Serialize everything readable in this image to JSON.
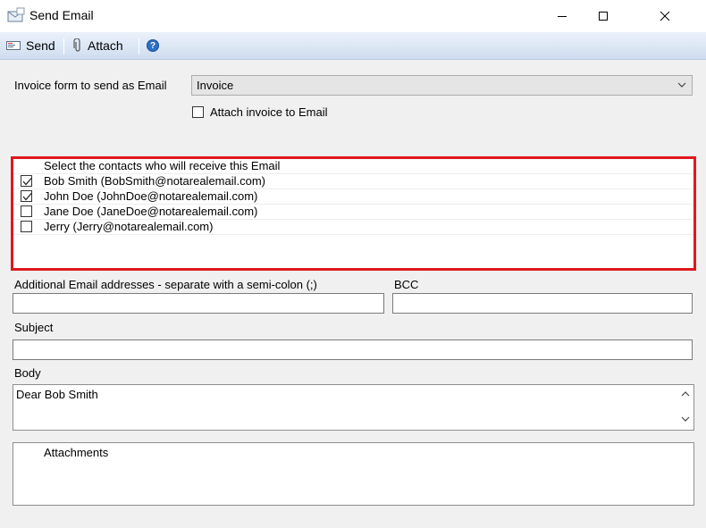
{
  "window": {
    "title": "Send Email",
    "icon": "send-mail-icon"
  },
  "toolbar": {
    "send_label": "Send",
    "attach_label": "Attach",
    "help_icon": "help-icon"
  },
  "form": {
    "invoice_form_label": "Invoice form to send as Email",
    "invoice_form_value": "Invoice",
    "attach_invoice_label": "Attach invoice to Email",
    "attach_invoice_checked": false
  },
  "contacts": {
    "header": "Select the contacts who will receive this Email",
    "items": [
      {
        "label": "Bob Smith (BobSmith@notarealemail.com)",
        "checked": true
      },
      {
        "label": "John Doe (JohnDoe@notarealemail.com)",
        "checked": true
      },
      {
        "label": "Jane Doe (JaneDoe@notarealemail.com)",
        "checked": false
      },
      {
        "label": "Jerry (Jerry@notarealemail.com)",
        "checked": false
      }
    ],
    "highlight_color": "#e0181f"
  },
  "additional": {
    "label": "Additional Email addresses - separate with a semi-colon (;)",
    "value": ""
  },
  "bcc": {
    "label": "BCC",
    "value": ""
  },
  "subject": {
    "label": "Subject",
    "value": ""
  },
  "body": {
    "label": "Body",
    "value": "Dear Bob Smith"
  },
  "attachments": {
    "header": "Attachments"
  }
}
